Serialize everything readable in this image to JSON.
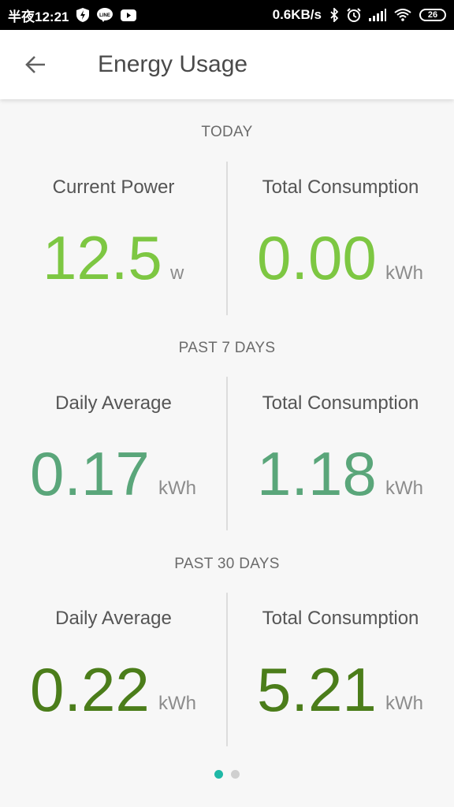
{
  "status_bar": {
    "time": "半夜12:21",
    "network_speed": "0.6KB/s",
    "battery": "26",
    "icons": [
      "bolt-shield-icon",
      "line-app-icon",
      "youtube-icon",
      "bluetooth-icon",
      "alarm-icon",
      "signal-icon",
      "wifi-icon",
      "battery-icon"
    ]
  },
  "app_bar": {
    "title": "Energy Usage",
    "back_icon": "back-arrow-icon"
  },
  "sections": [
    {
      "title": "TODAY",
      "left": {
        "label": "Current Power",
        "value": "12.5",
        "unit": "w",
        "color": "#7dc742"
      },
      "right": {
        "label": "Total Consumption",
        "value": "0.00",
        "unit": "kWh",
        "color": "#7dc742"
      }
    },
    {
      "title": "PAST 7 DAYS",
      "left": {
        "label": "Daily Average",
        "value": "0.17",
        "unit": "kWh",
        "color": "#5aa67a"
      },
      "right": {
        "label": "Total Consumption",
        "value": "1.18",
        "unit": "kWh",
        "color": "#5aa67a"
      }
    },
    {
      "title": "PAST 30 DAYS",
      "left": {
        "label": "Daily Average",
        "value": "0.22",
        "unit": "kWh",
        "color": "#4b7d1a"
      },
      "right": {
        "label": "Total Consumption",
        "value": "5.21",
        "unit": "kWh",
        "color": "#4b7d1a"
      }
    }
  ],
  "pager": {
    "pages": 2,
    "active": 1,
    "active_color": "#1fb8a6"
  }
}
